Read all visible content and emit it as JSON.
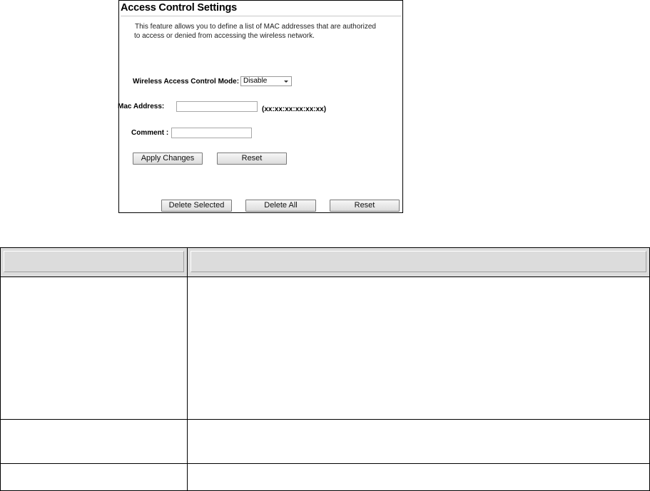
{
  "panel": {
    "title": "Access Control Settings",
    "intro_line1": "This feature allows you to define a list of MAC addresses that are authorized",
    "intro_line2": "to access or denied from accessing the wireless network.",
    "mode_label": "Wireless Access Control Mode:",
    "mode_value": "Disable",
    "mac_label": "Mac Address:",
    "mac_value": "",
    "mac_format": "(xx:xx:xx:xx:xx:xx)",
    "comment_label": "Comment :",
    "comment_value": "",
    "apply_button": "Apply Changes",
    "reset_button": "Reset",
    "delete_selected_button": "Delete Selected",
    "delete_all_button": "Delete All",
    "reset_list_button": "Reset"
  },
  "table": {
    "header": [
      "",
      ""
    ],
    "rows": [
      [
        "",
        ""
      ],
      [
        "",
        ""
      ],
      [
        "",
        ""
      ]
    ]
  },
  "colors": {
    "table_header_bg": "#dcdcdc",
    "border": "#000000",
    "button_bg": "#e8e8e8"
  }
}
